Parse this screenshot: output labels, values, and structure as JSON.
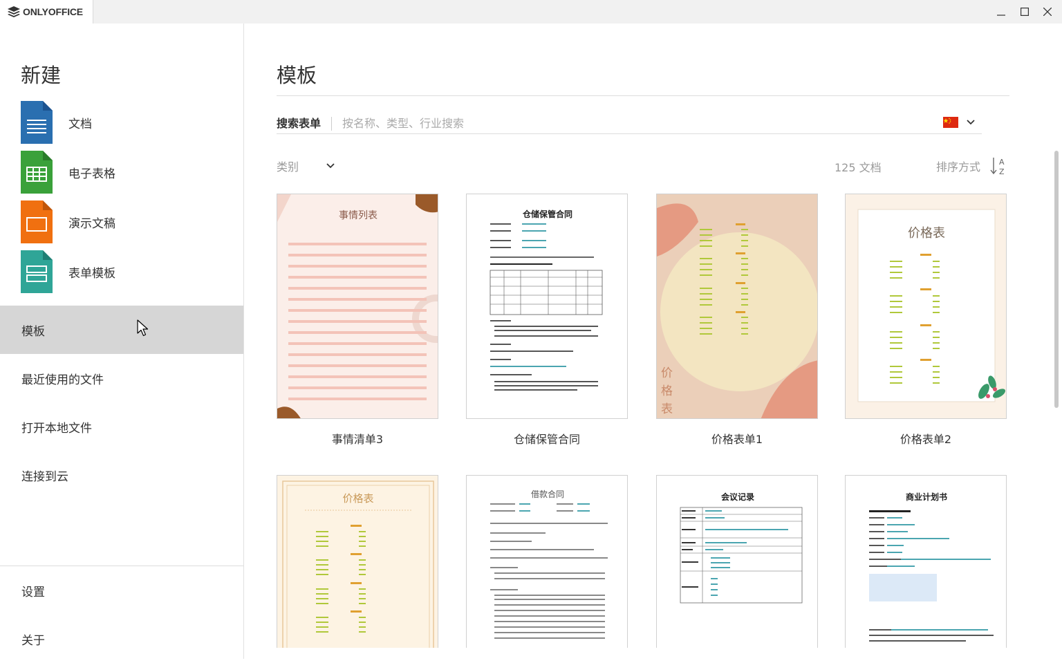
{
  "app": {
    "brand": "ONLYOFFICE"
  },
  "sidebar": {
    "new_title": "新建",
    "create_items": [
      {
        "label": "文档",
        "icon": "document-icon",
        "color": "#2a6fb0"
      },
      {
        "label": "电子表格",
        "icon": "spreadsheet-icon",
        "color": "#3aa13a"
      },
      {
        "label": "演示文稿",
        "icon": "presentation-icon",
        "color": "#f07010"
      },
      {
        "label": "表单模板",
        "icon": "form-template-icon",
        "color": "#2fa597"
      }
    ],
    "nav_items": [
      {
        "label": "模板",
        "active": true
      },
      {
        "label": "最近使用的文件",
        "active": false
      },
      {
        "label": "打开本地文件",
        "active": false
      },
      {
        "label": "连接到云",
        "active": false
      }
    ],
    "bottom_items": [
      {
        "label": "设置"
      },
      {
        "label": "关于"
      }
    ]
  },
  "main": {
    "title": "模板",
    "search": {
      "label": "搜索表单",
      "placeholder": "按名称、类型、行业搜索",
      "value": ""
    },
    "language_flag": "flag-china-icon",
    "filter": {
      "category_label": "类别",
      "count_text": "125 文档",
      "sort_label": "排序方式"
    },
    "templates": [
      {
        "name": "事情清单3",
        "thumb_title": "事情列表"
      },
      {
        "name": "仓储保管合同",
        "thumb_title": "仓储保管合同"
      },
      {
        "name": "价格表单1",
        "thumb_title": "价格表"
      },
      {
        "name": "价格表单2",
        "thumb_title": "价格表"
      },
      {
        "name": "",
        "thumb_title": "价格表"
      },
      {
        "name": "",
        "thumb_title": "借款合同"
      },
      {
        "name": "",
        "thumb_title": "会议记录"
      },
      {
        "name": "",
        "thumb_title": "商业计划书"
      }
    ]
  }
}
